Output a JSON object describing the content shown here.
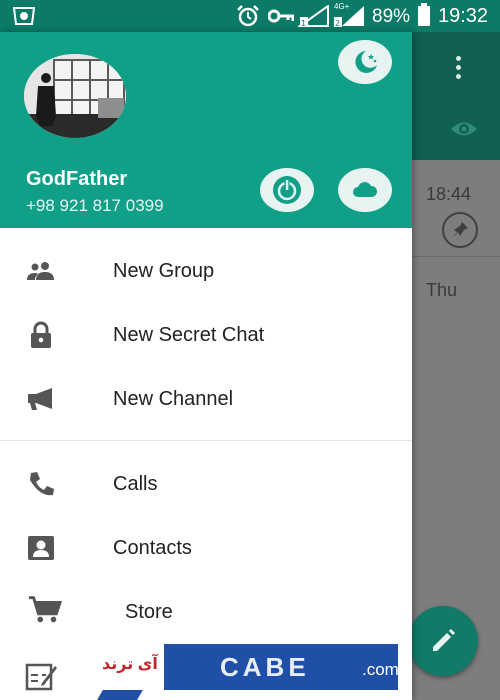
{
  "status_bar": {
    "battery_percent": "89%",
    "time": "19:32",
    "sim2_label": "4G+",
    "icons": [
      "app-icon",
      "alarm-icon",
      "vpn-key-icon",
      "sim1-signal-icon",
      "sim2-signal-icon",
      "battery-icon"
    ]
  },
  "drawer": {
    "header": {
      "user_name": "GodFather",
      "phone": "+98 921 817 0399",
      "buttons": [
        "night-mode-icon",
        "power-icon",
        "cloud-icon"
      ]
    },
    "menu": [
      {
        "label": "New Group",
        "icon": "group-icon"
      },
      {
        "label": "New Secret Chat",
        "icon": "lock-icon"
      },
      {
        "label": "New Channel",
        "icon": "megaphone-icon"
      },
      {
        "label": "Calls",
        "icon": "phone-icon"
      },
      {
        "label": "Contacts",
        "icon": "contacts-icon"
      },
      {
        "label": "Store",
        "icon": "cart-icon"
      }
    ]
  },
  "background_chat": {
    "times": [
      "18:44",
      "Thu"
    ]
  },
  "watermark": {
    "persian_text": "آی ترند",
    "letters": "CABE",
    "domain": ".com"
  },
  "colors": {
    "header_teal": "#10a088",
    "status_bar_teal": "#0b7a66",
    "fab": "#127a68",
    "icon_gray": "#555555"
  }
}
